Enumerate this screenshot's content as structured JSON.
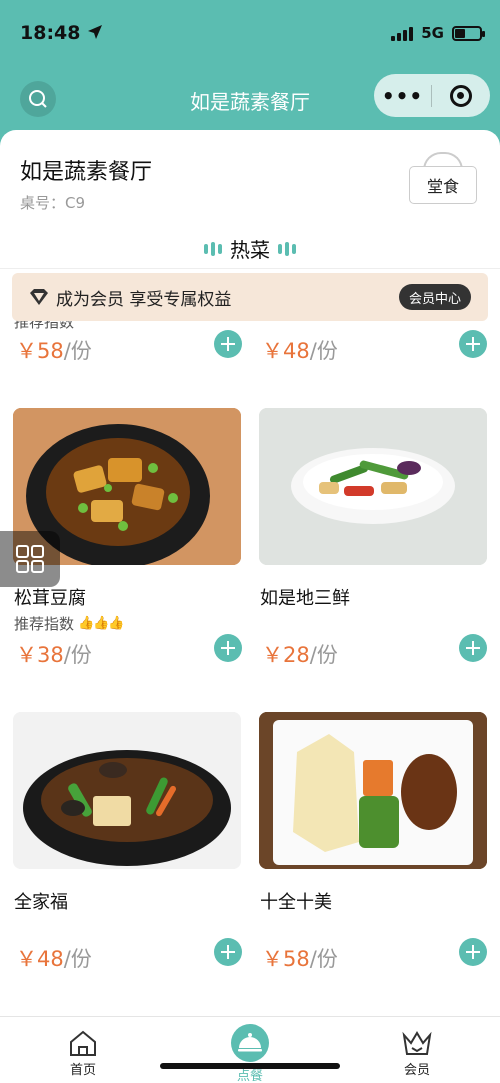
{
  "status_bar": {
    "time": "18:48",
    "network": "5G"
  },
  "nav": {
    "title": "如是蔬素餐厅"
  },
  "header": {
    "restaurant_name": "如是蔬素餐厅",
    "table_no": "桌号：C9",
    "dine_tag": "堂食"
  },
  "section": {
    "title": "热菜"
  },
  "member_banner": {
    "text": "成为会员 享受专属权益",
    "button": "会员中心"
  },
  "partial_row": {
    "label": "推荐指数",
    "items": [
      {
        "price": "￥58",
        "unit": "/份"
      },
      {
        "price": "￥48",
        "unit": "/份"
      }
    ]
  },
  "dishes": [
    {
      "name": "松茸豆腐",
      "rec_label": "推荐指数",
      "price": "￥38",
      "unit": "/份"
    },
    {
      "name": "如是地三鲜",
      "price": "￥28",
      "unit": "/份"
    },
    {
      "name": "全家福",
      "price": "￥48",
      "unit": "/份"
    },
    {
      "name": "十全十美",
      "price": "￥58",
      "unit": "/份"
    }
  ],
  "tabs": [
    {
      "label": "首页"
    },
    {
      "label": "点餐"
    },
    {
      "label": "会员"
    }
  ],
  "colors": {
    "accent": "#5bbdb1",
    "price": "#e8743b",
    "banner": "#f6e7d9"
  }
}
